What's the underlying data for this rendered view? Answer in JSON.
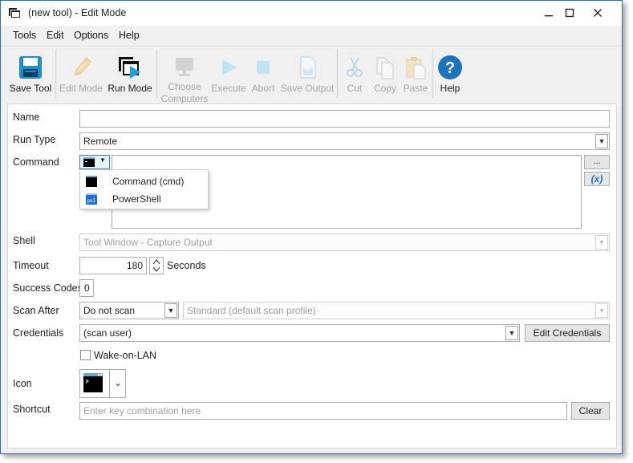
{
  "window": {
    "title": "(new tool) - Edit Mode"
  },
  "menu": [
    "Tools",
    "Edit",
    "Options",
    "Help"
  ],
  "toolbar": {
    "save_tool": "Save Tool",
    "edit_mode": "Edit Mode",
    "run_mode": "Run Mode",
    "choose_computers_1": "Choose",
    "choose_computers_2": "Computers",
    "execute": "Execute",
    "abort": "Abort",
    "save_output": "Save Output",
    "cut": "Cut",
    "copy": "Copy",
    "paste": "Paste",
    "help": "Help"
  },
  "form": {
    "name_label": "Name",
    "name_value": "",
    "run_type_label": "Run Type",
    "run_type_value": "Remote",
    "command_label": "Command",
    "command_browse": "...",
    "command_variable": "(x)",
    "command_options": [
      "Command (cmd)",
      "PowerShell"
    ],
    "ps_icon_text": "ps1",
    "shell_label": "Shell",
    "shell_value": "Tool Window - Capture Output",
    "timeout_label": "Timeout",
    "timeout_value": "180",
    "timeout_unit": "Seconds",
    "success_codes_label": "Success Codes",
    "success_codes_value": "0",
    "scan_after_label": "Scan After",
    "scan_after_value": "Do not scan",
    "scan_profile_value": "Standard (default scan profile)",
    "credentials_label": "Credentials",
    "credentials_value": "(scan user)",
    "edit_credentials": "Edit Credentials",
    "wol_label": "Wake-on-LAN",
    "wol_checked": false,
    "icon_label": "Icon",
    "shortcut_label": "Shortcut",
    "shortcut_placeholder": "Enter key combination here",
    "clear": "Clear"
  },
  "colors": {
    "accent": "#2b6cc4",
    "help_blue": "#1e73be",
    "save_teal": "#1e8fc8",
    "run_blue": "#1fa2d8",
    "disabled": "#a6a6a6"
  }
}
